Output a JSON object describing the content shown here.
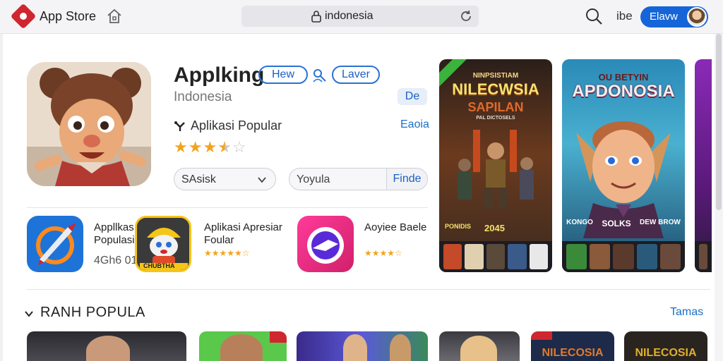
{
  "topbar": {
    "app_name": "App Store",
    "url": "indonesia",
    "short_label": "ibe",
    "user_button": "Elavw"
  },
  "featured_app": {
    "title": "Applking",
    "chip_new": "Hew",
    "chip_later": "Laver",
    "country": "Indonesia",
    "badge": "De",
    "category": "Aplikasi Popular",
    "category_link": "Eaoia",
    "rating": 3.5,
    "stars_max": 5,
    "select_value": "SAsisk",
    "search_placeholder": "Yoyula",
    "search_button": "Finde"
  },
  "mini_apps": [
    {
      "title_line1": "Appllkas",
      "title_line2": "Populasi",
      "meta": "4Gh6 01F"
    },
    {
      "title_line1": "Aplikasi Apresiar",
      "title_line2": "Foular",
      "stars": "★★★★★☆"
    },
    {
      "title_line1": "Aoyiee Baele",
      "title_line2": "",
      "stars": "★★★★☆"
    }
  ],
  "mini_game_label": "CHUBTHA",
  "banners": [
    {
      "title_top": "NINPSISTIAM",
      "title_main": "NILECWSIA",
      "title_sub": "SAPILAN",
      "tagline": "PAL DICTOSELS",
      "footer_left": "PONIDIS",
      "footer_year": "2045"
    },
    {
      "title_top": "OU BETYIN",
      "title_main": "APDONOSIA",
      "footer_left": "KONGO",
      "footer_mid": "SOLKS",
      "footer_right": "DEW BROW"
    }
  ],
  "section": {
    "title": "RANH POPULA",
    "link": "Tamas"
  },
  "bottom_cards": [
    {
      "label": ""
    },
    {
      "label": ""
    },
    {
      "label": ""
    },
    {
      "label": ""
    },
    {
      "label": "NILECOSIA"
    },
    {
      "label": "NILECOSIA"
    }
  ],
  "colors": {
    "accent": "#1565d8",
    "brand": "#d0262f",
    "star": "#f2a41c"
  }
}
